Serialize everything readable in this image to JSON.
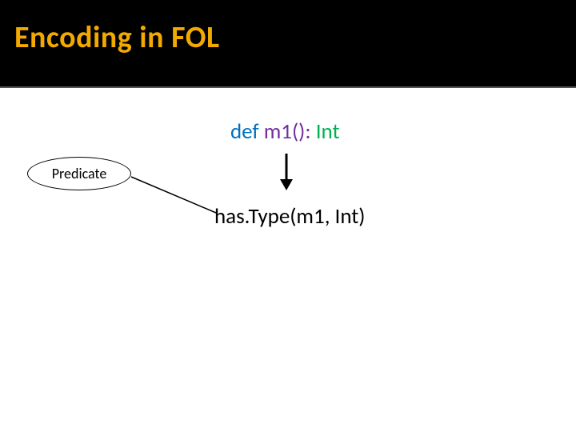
{
  "title": "Encoding in FOL",
  "code": {
    "keyword": "def ",
    "ident": "m1():",
    "colon": " ",
    "type": "Int"
  },
  "code_raw": "def m1(): Int",
  "predicate_label": "Predicate",
  "expression": "has.Type(m1, Int)"
}
